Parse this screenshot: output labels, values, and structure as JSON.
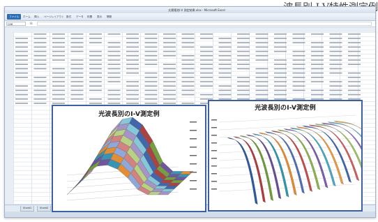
{
  "caption": "波長別 I-V特性測定例",
  "window": {
    "title": "太陽電池I-V 測定結果.xlsx - Microsoft Excel"
  },
  "ribbon": {
    "tabs": [
      "ファイル",
      "ホーム",
      "挿入",
      "ページレイアウト",
      "数式",
      "データ",
      "校閲",
      "表示",
      "開発"
    ]
  },
  "formula_bar": {
    "name_box": "Q36",
    "fx": "fx"
  },
  "sheet_tabs": [
    "Sheet1",
    "Sheet2",
    "Sheet3",
    "Sheet4",
    "Sheet5",
    "Sheet6"
  ],
  "active_sheet_index": 3,
  "charts": [
    {
      "title": "光波長別のI-V測定例"
    },
    {
      "title": "光波長別のI-V測定例"
    }
  ],
  "colors": {
    "chart_border": "#3d5fa3",
    "grid_line": "#dfe4ea",
    "ribbon_file_tab": "#2f6db3"
  }
}
